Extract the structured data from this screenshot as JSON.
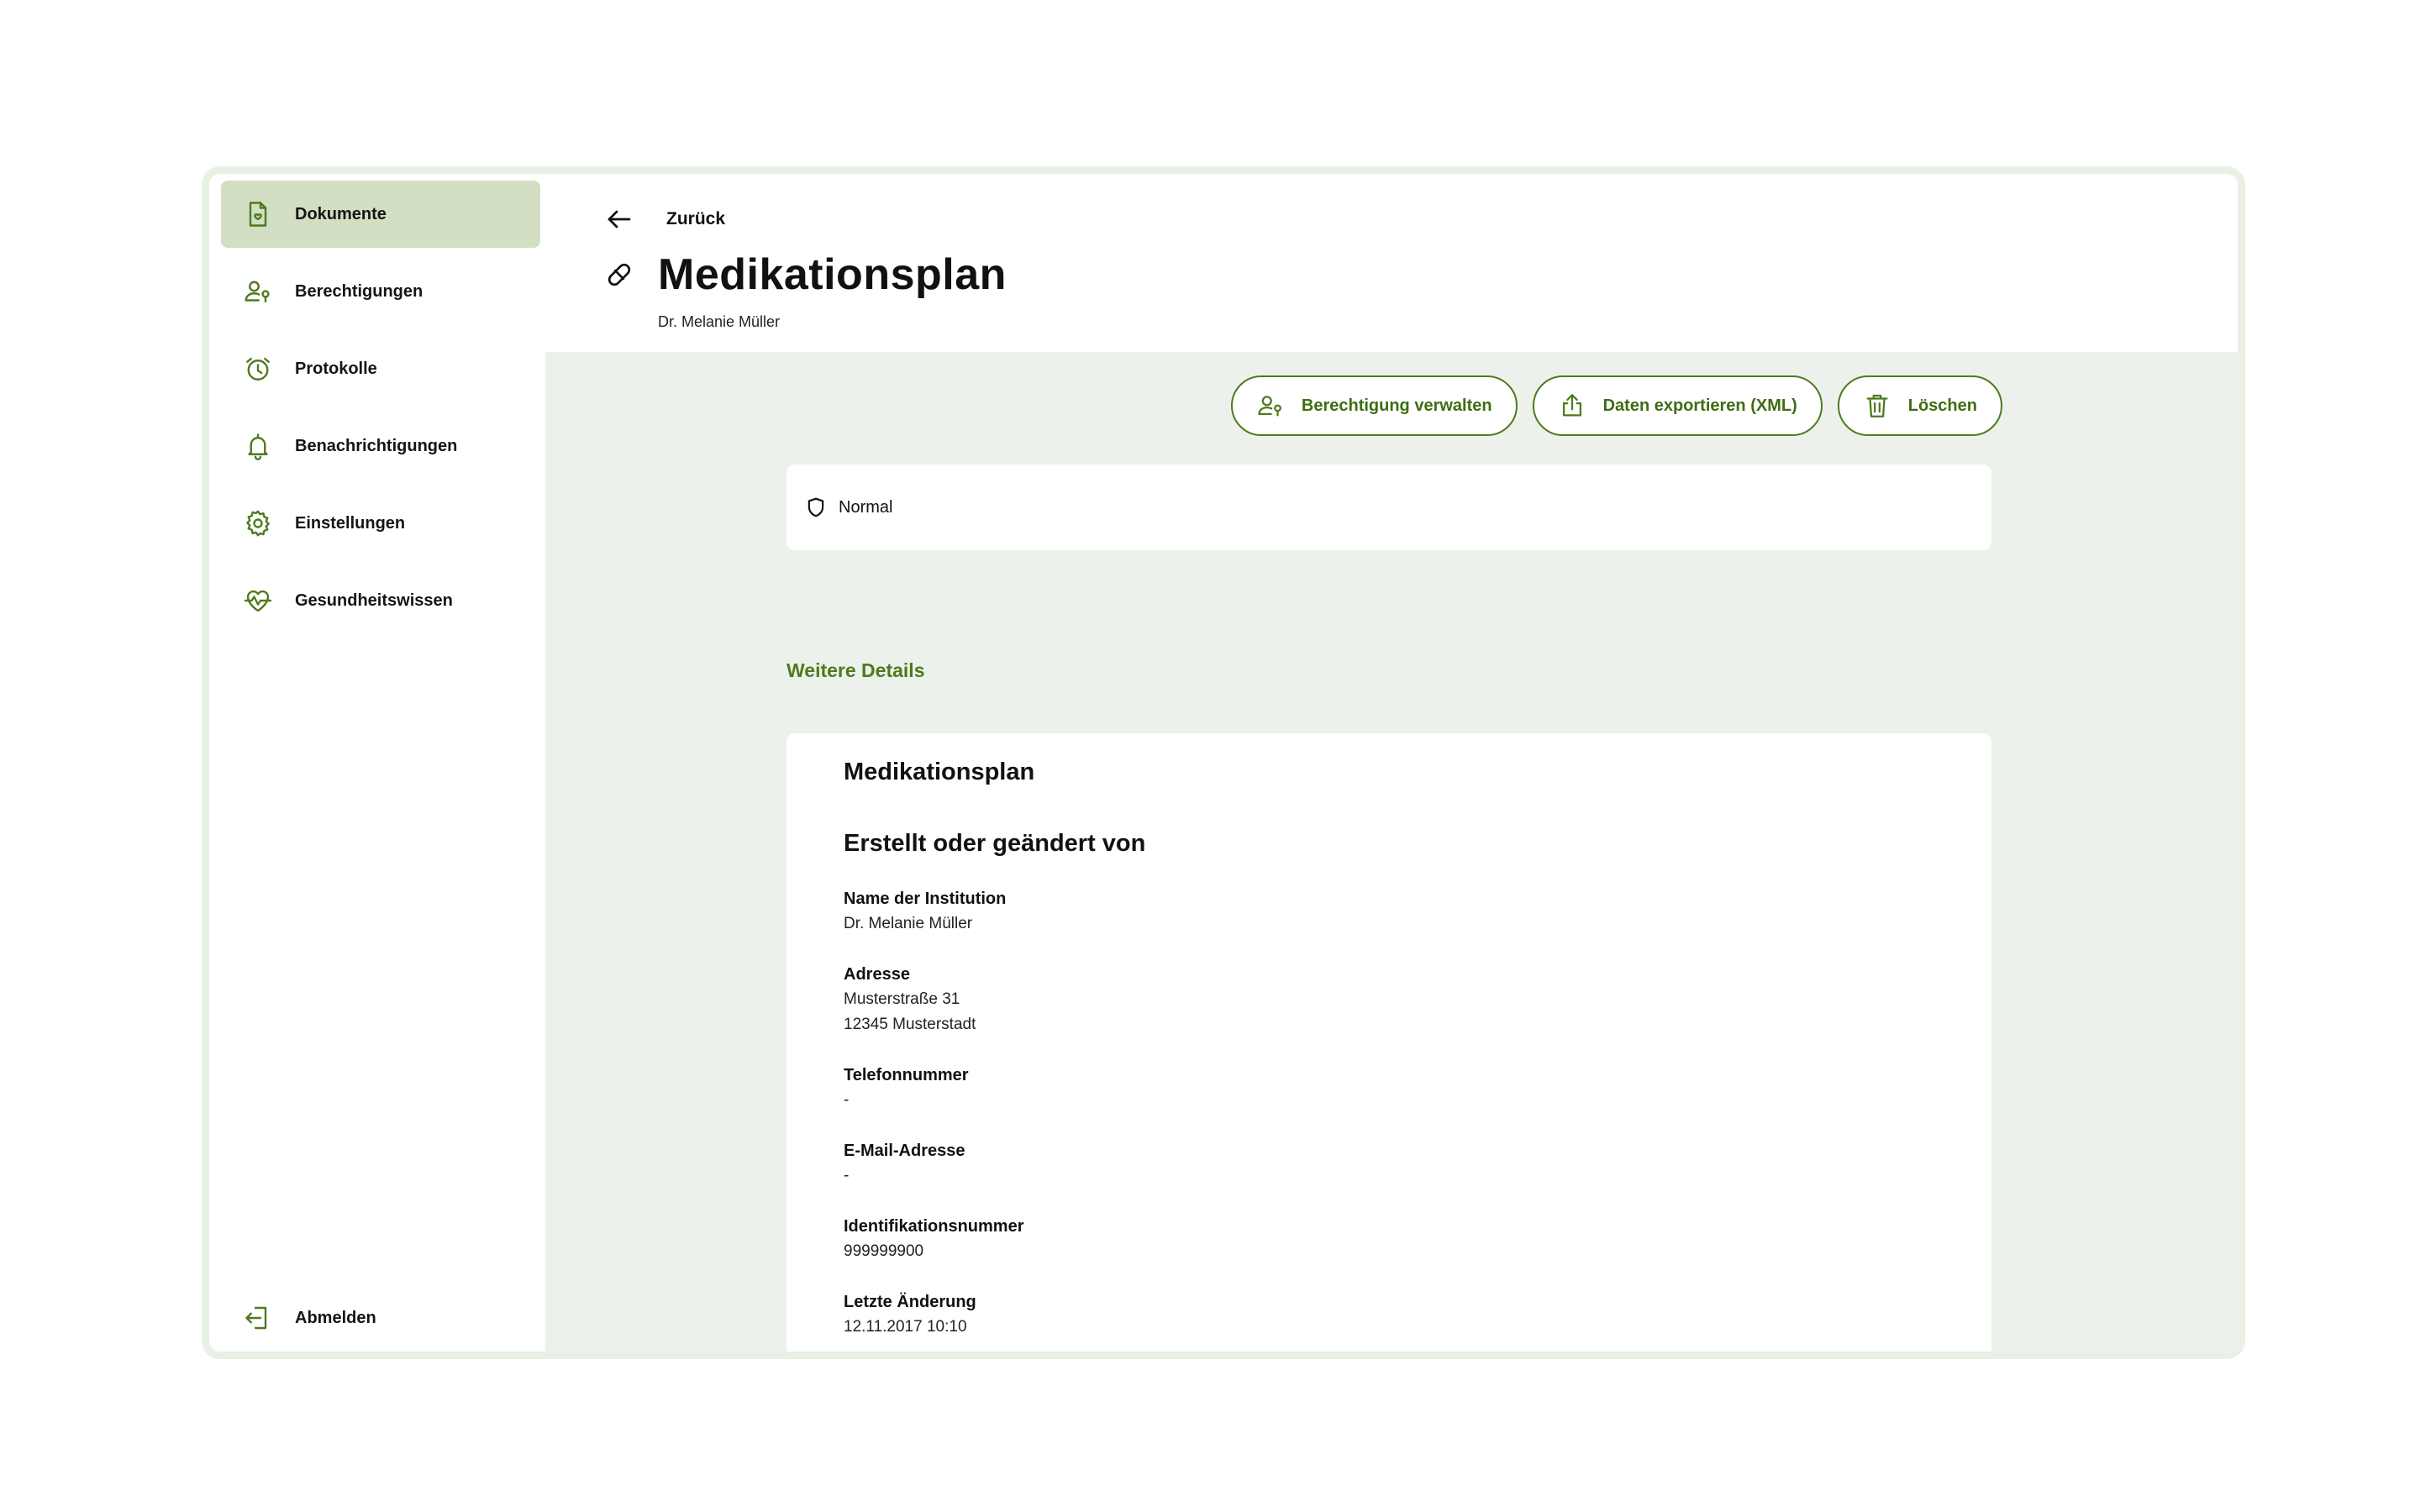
{
  "sidebar": {
    "items": [
      {
        "label": "Dokumente",
        "icon": "document-icon",
        "active": true
      },
      {
        "label": "Berechtigungen",
        "icon": "user-key-icon"
      },
      {
        "label": "Protokolle",
        "icon": "alarm-clock-icon"
      },
      {
        "label": "Benachrichtigungen",
        "icon": "bell-icon"
      },
      {
        "label": "Einstellungen",
        "icon": "gear-icon"
      },
      {
        "label": "Gesundheitswissen",
        "icon": "heart-pulse-icon"
      }
    ],
    "logout": {
      "label": "Abmelden",
      "icon": "logout-icon"
    }
  },
  "header": {
    "back_label": "Zurück",
    "title": "Medikationsplan",
    "subtitle": "Dr. Melanie Müller",
    "title_icon": "pill-icon"
  },
  "actions": {
    "manage_label": "Berechtigung verwalten",
    "export_label": "Daten exportieren (XML)",
    "delete_label": "Löschen"
  },
  "status": {
    "label": "Normal",
    "icon": "shield-icon"
  },
  "details": {
    "section_link": "Weitere Details",
    "card_title": "Medikationsplan",
    "subheading": "Erstellt oder geändert von",
    "fields": [
      {
        "label": "Name der Institution",
        "value": [
          "Dr. Melanie Müller"
        ]
      },
      {
        "label": "Adresse",
        "value": [
          "Musterstraße 31",
          "12345 Musterstadt"
        ]
      },
      {
        "label": "Telefonnummer",
        "value": [
          "-"
        ]
      },
      {
        "label": "E-Mail-Adresse",
        "value": [
          "-"
        ]
      },
      {
        "label": "Identifikationsnummer",
        "value": [
          "999999900"
        ]
      },
      {
        "label": "Letzte Änderung",
        "value": [
          "12.11.2017 10:10"
        ]
      }
    ]
  },
  "colors": {
    "accent": "#4e7a1f",
    "active_bg": "#d3dfc3",
    "main_bg": "#ecf2eb",
    "frame": "#e9f1e6"
  }
}
